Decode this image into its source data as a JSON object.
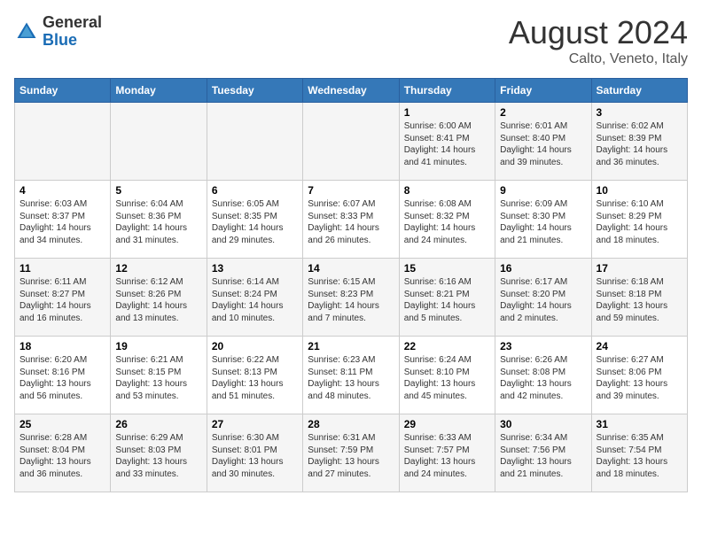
{
  "header": {
    "logo_general": "General",
    "logo_blue": "Blue",
    "title": "August 2024",
    "subtitle": "Calto, Veneto, Italy"
  },
  "days_of_week": [
    "Sunday",
    "Monday",
    "Tuesday",
    "Wednesday",
    "Thursday",
    "Friday",
    "Saturday"
  ],
  "weeks": [
    [
      {
        "day": "",
        "info": ""
      },
      {
        "day": "",
        "info": ""
      },
      {
        "day": "",
        "info": ""
      },
      {
        "day": "",
        "info": ""
      },
      {
        "day": "1",
        "info": "Sunrise: 6:00 AM\nSunset: 8:41 PM\nDaylight: 14 hours\nand 41 minutes."
      },
      {
        "day": "2",
        "info": "Sunrise: 6:01 AM\nSunset: 8:40 PM\nDaylight: 14 hours\nand 39 minutes."
      },
      {
        "day": "3",
        "info": "Sunrise: 6:02 AM\nSunset: 8:39 PM\nDaylight: 14 hours\nand 36 minutes."
      }
    ],
    [
      {
        "day": "4",
        "info": "Sunrise: 6:03 AM\nSunset: 8:37 PM\nDaylight: 14 hours\nand 34 minutes."
      },
      {
        "day": "5",
        "info": "Sunrise: 6:04 AM\nSunset: 8:36 PM\nDaylight: 14 hours\nand 31 minutes."
      },
      {
        "day": "6",
        "info": "Sunrise: 6:05 AM\nSunset: 8:35 PM\nDaylight: 14 hours\nand 29 minutes."
      },
      {
        "day": "7",
        "info": "Sunrise: 6:07 AM\nSunset: 8:33 PM\nDaylight: 14 hours\nand 26 minutes."
      },
      {
        "day": "8",
        "info": "Sunrise: 6:08 AM\nSunset: 8:32 PM\nDaylight: 14 hours\nand 24 minutes."
      },
      {
        "day": "9",
        "info": "Sunrise: 6:09 AM\nSunset: 8:30 PM\nDaylight: 14 hours\nand 21 minutes."
      },
      {
        "day": "10",
        "info": "Sunrise: 6:10 AM\nSunset: 8:29 PM\nDaylight: 14 hours\nand 18 minutes."
      }
    ],
    [
      {
        "day": "11",
        "info": "Sunrise: 6:11 AM\nSunset: 8:27 PM\nDaylight: 14 hours\nand 16 minutes."
      },
      {
        "day": "12",
        "info": "Sunrise: 6:12 AM\nSunset: 8:26 PM\nDaylight: 14 hours\nand 13 minutes."
      },
      {
        "day": "13",
        "info": "Sunrise: 6:14 AM\nSunset: 8:24 PM\nDaylight: 14 hours\nand 10 minutes."
      },
      {
        "day": "14",
        "info": "Sunrise: 6:15 AM\nSunset: 8:23 PM\nDaylight: 14 hours\nand 7 minutes."
      },
      {
        "day": "15",
        "info": "Sunrise: 6:16 AM\nSunset: 8:21 PM\nDaylight: 14 hours\nand 5 minutes."
      },
      {
        "day": "16",
        "info": "Sunrise: 6:17 AM\nSunset: 8:20 PM\nDaylight: 14 hours\nand 2 minutes."
      },
      {
        "day": "17",
        "info": "Sunrise: 6:18 AM\nSunset: 8:18 PM\nDaylight: 13 hours\nand 59 minutes."
      }
    ],
    [
      {
        "day": "18",
        "info": "Sunrise: 6:20 AM\nSunset: 8:16 PM\nDaylight: 13 hours\nand 56 minutes."
      },
      {
        "day": "19",
        "info": "Sunrise: 6:21 AM\nSunset: 8:15 PM\nDaylight: 13 hours\nand 53 minutes."
      },
      {
        "day": "20",
        "info": "Sunrise: 6:22 AM\nSunset: 8:13 PM\nDaylight: 13 hours\nand 51 minutes."
      },
      {
        "day": "21",
        "info": "Sunrise: 6:23 AM\nSunset: 8:11 PM\nDaylight: 13 hours\nand 48 minutes."
      },
      {
        "day": "22",
        "info": "Sunrise: 6:24 AM\nSunset: 8:10 PM\nDaylight: 13 hours\nand 45 minutes."
      },
      {
        "day": "23",
        "info": "Sunrise: 6:26 AM\nSunset: 8:08 PM\nDaylight: 13 hours\nand 42 minutes."
      },
      {
        "day": "24",
        "info": "Sunrise: 6:27 AM\nSunset: 8:06 PM\nDaylight: 13 hours\nand 39 minutes."
      }
    ],
    [
      {
        "day": "25",
        "info": "Sunrise: 6:28 AM\nSunset: 8:04 PM\nDaylight: 13 hours\nand 36 minutes."
      },
      {
        "day": "26",
        "info": "Sunrise: 6:29 AM\nSunset: 8:03 PM\nDaylight: 13 hours\nand 33 minutes."
      },
      {
        "day": "27",
        "info": "Sunrise: 6:30 AM\nSunset: 8:01 PM\nDaylight: 13 hours\nand 30 minutes."
      },
      {
        "day": "28",
        "info": "Sunrise: 6:31 AM\nSunset: 7:59 PM\nDaylight: 13 hours\nand 27 minutes."
      },
      {
        "day": "29",
        "info": "Sunrise: 6:33 AM\nSunset: 7:57 PM\nDaylight: 13 hours\nand 24 minutes."
      },
      {
        "day": "30",
        "info": "Sunrise: 6:34 AM\nSunset: 7:56 PM\nDaylight: 13 hours\nand 21 minutes."
      },
      {
        "day": "31",
        "info": "Sunrise: 6:35 AM\nSunset: 7:54 PM\nDaylight: 13 hours\nand 18 minutes."
      }
    ]
  ]
}
